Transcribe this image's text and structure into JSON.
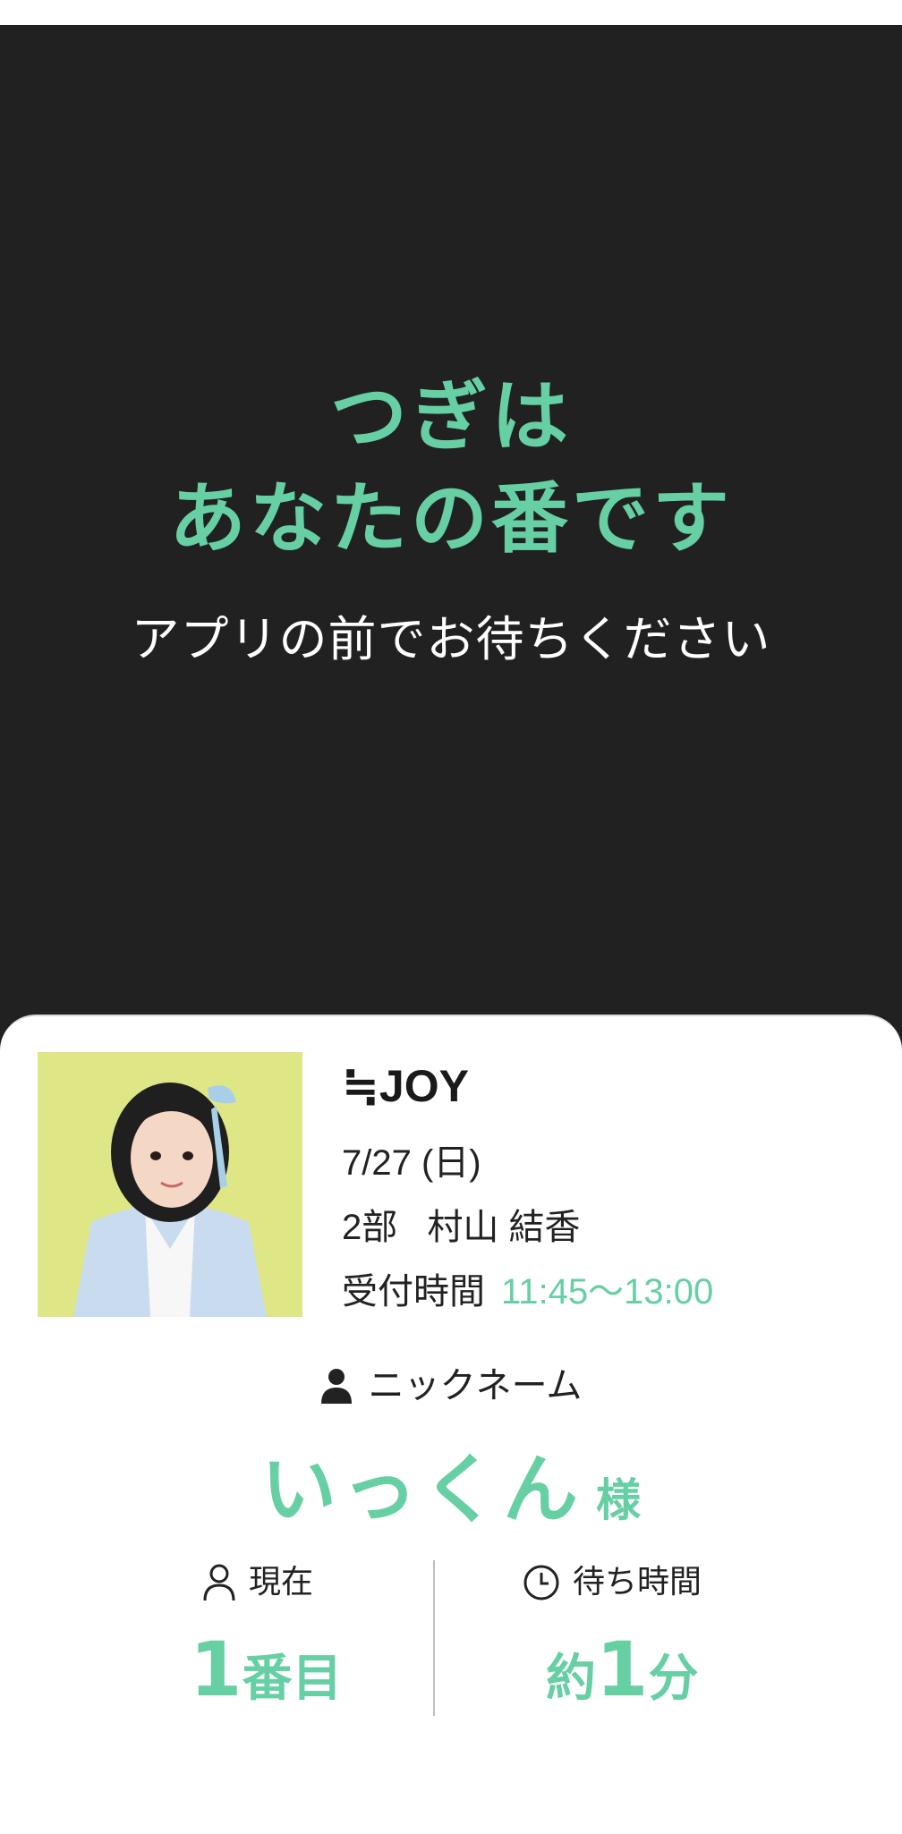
{
  "hero": {
    "title_line1": "つぎは",
    "title_line2": "あなたの番です",
    "subtitle": "アプリの前でお待ちください"
  },
  "event": {
    "group_name": "≒JOY",
    "date": "7/27 (日)",
    "session": "2部",
    "member_name": "村山 結香",
    "reception_label": "受付時間",
    "reception_time": "11:45〜13:00"
  },
  "nickname": {
    "label": "ニックネーム",
    "value": "いっくん",
    "suffix": "様"
  },
  "status": {
    "current_label": "現在",
    "current_value": "1",
    "current_unit": "番目",
    "wait_label": "待ち時間",
    "wait_prefix": "約",
    "wait_value": "1",
    "wait_unit": "分"
  },
  "colors": {
    "accent": "#67cfa4",
    "dark_bg": "#212121"
  },
  "icons": {
    "nickname": "person-solid-icon",
    "current": "person-outline-icon",
    "wait": "clock-icon"
  }
}
